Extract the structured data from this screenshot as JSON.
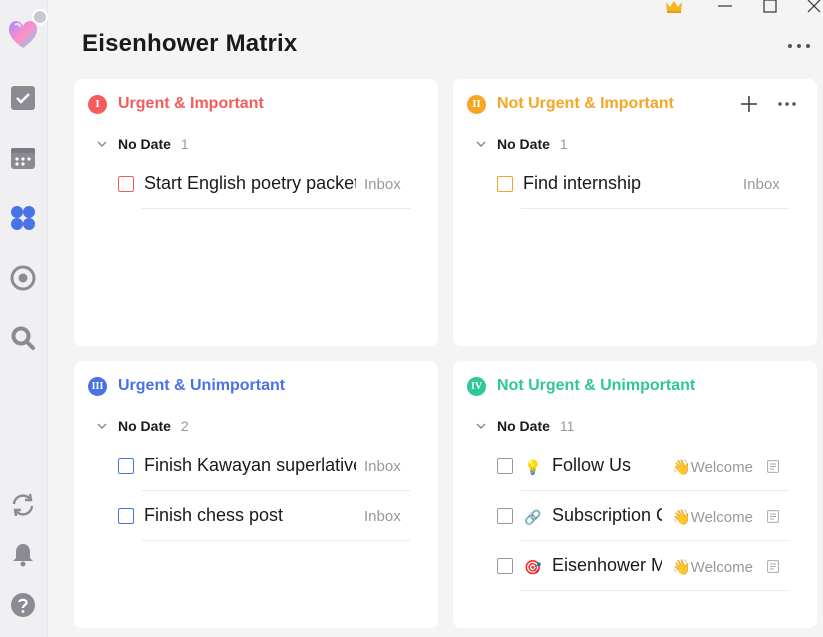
{
  "window": {
    "title": "Eisenhower Matrix",
    "controls": [
      "premium-crown",
      "minimize",
      "maximize",
      "close"
    ]
  },
  "sidebar": {
    "items": [
      {
        "name": "tasks",
        "icon": "checkbox-icon"
      },
      {
        "name": "calendar",
        "icon": "calendar-icon"
      },
      {
        "name": "matrix",
        "icon": "four-squares-icon",
        "active": true
      },
      {
        "name": "focus",
        "icon": "target-icon"
      },
      {
        "name": "search",
        "icon": "search-icon"
      },
      {
        "name": "sync",
        "icon": "sync-icon"
      },
      {
        "name": "notifications",
        "icon": "bell-icon"
      },
      {
        "name": "help",
        "icon": "help-icon"
      }
    ]
  },
  "quadrants": [
    {
      "badge": "I",
      "title": "Urgent & Important",
      "color": "#f25c5c",
      "group": {
        "label": "No Date",
        "count": "1"
      },
      "tasks": [
        {
          "title": "Start English poetry packet",
          "list": "Inbox"
        }
      ]
    },
    {
      "badge": "II",
      "title": "Not Urgent & Important",
      "color": "#f5a623",
      "group": {
        "label": "No Date",
        "count": "1"
      },
      "tasks": [
        {
          "title": "Find internship",
          "list": "Inbox"
        }
      ]
    },
    {
      "badge": "III",
      "title": "Urgent & Unimportant",
      "color": "#4a72e8",
      "group": {
        "label": "No Date",
        "count": "2"
      },
      "tasks": [
        {
          "title": "Finish Kawayan superlatives",
          "list": "Inbox"
        },
        {
          "title": "Finish chess post",
          "list": "Inbox"
        }
      ]
    },
    {
      "badge": "IV",
      "title": "Not Urgent & Unimportant",
      "color": "#2ec79a",
      "group": {
        "label": "No Date",
        "count": "11"
      },
      "tasks": [
        {
          "title": "Follow Us",
          "list": "👋Welcome",
          "emoji": "💡"
        },
        {
          "title": "Subscription Calendar",
          "list": "👋Welcome",
          "emoji": "🔗"
        },
        {
          "title": "Eisenhower Matrix",
          "list": "👋Welcome",
          "emoji": "🎯"
        }
      ]
    }
  ]
}
